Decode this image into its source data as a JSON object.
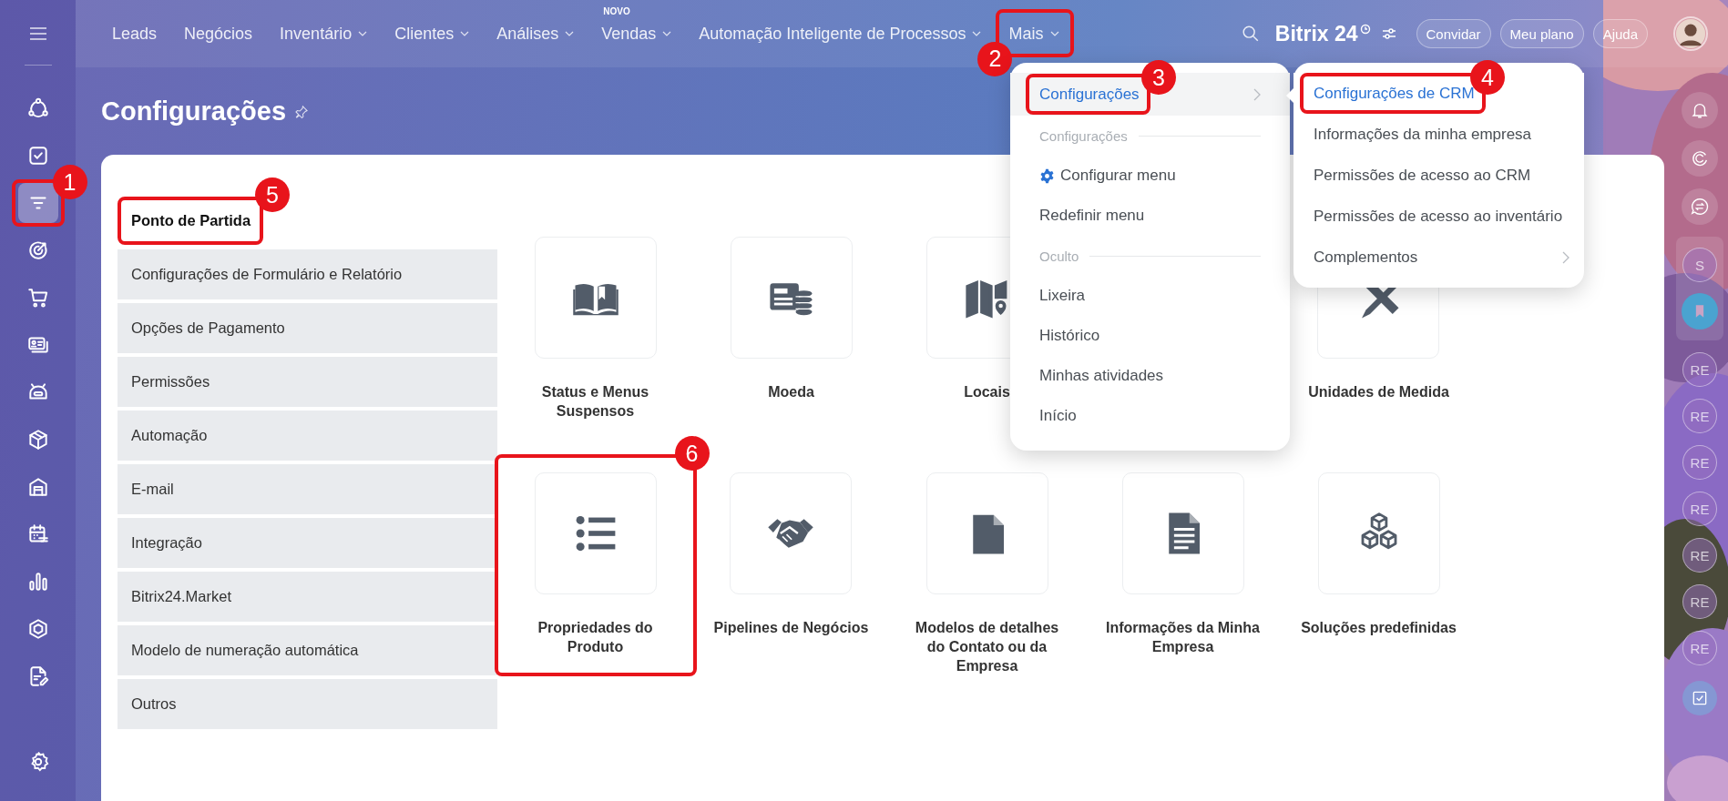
{
  "sidebar": {
    "items": [
      {
        "selected": false
      },
      {
        "selected": false
      },
      {
        "selected": true,
        "callout": "1"
      },
      {
        "selected": false
      },
      {
        "selected": false
      },
      {
        "selected": false
      },
      {
        "selected": false
      },
      {
        "selected": false
      },
      {
        "selected": false
      },
      {
        "selected": false
      },
      {
        "selected": false
      },
      {
        "selected": false
      },
      {
        "selected": false
      }
    ]
  },
  "top_nav": {
    "items": [
      {
        "label": "Leads",
        "dropdown": false
      },
      {
        "label": "Negócios",
        "dropdown": false
      },
      {
        "label": "Inventário",
        "dropdown": true
      },
      {
        "label": "Clientes",
        "dropdown": true
      },
      {
        "label": "Análises",
        "dropdown": true
      },
      {
        "label": "Vendas",
        "dropdown": true,
        "badge": "NOVO"
      },
      {
        "label": "Automação Inteligente de Processos",
        "dropdown": true
      },
      {
        "label": "Mais",
        "dropdown": true,
        "callout": "2"
      }
    ]
  },
  "logo": "Bitrix 24",
  "header_buttons": [
    "Convidar",
    "Meu plano",
    "Ajuda"
  ],
  "page": {
    "title": "Configurações"
  },
  "settings_nav": [
    {
      "label": "Ponto de Partida",
      "selected": true,
      "callout": "5"
    },
    {
      "label": "Configurações de Formulário e Relatório",
      "selected": false
    },
    {
      "label": "Opções de Pagamento",
      "selected": false
    },
    {
      "label": "Permissões",
      "selected": false
    },
    {
      "label": "Automação",
      "selected": false
    },
    {
      "label": "E-mail",
      "selected": false
    },
    {
      "label": "Integração",
      "selected": false
    },
    {
      "label": "Bitrix24.Market",
      "selected": false
    },
    {
      "label": "Modelo de numeração automática",
      "selected": false
    },
    {
      "label": "Outros",
      "selected": false
    }
  ],
  "tiles": [
    {
      "kind": "tile",
      "label": "Status e Menus Suspensos"
    },
    {
      "kind": "tile",
      "label": "Moeda"
    },
    {
      "kind": "tile",
      "label": "Locais"
    },
    {
      "kind": "covered"
    },
    {
      "kind": "tile",
      "label": "Unidades de Medida"
    },
    {
      "kind": "tile",
      "label": "Propriedades do Produto",
      "callout": "6"
    },
    {
      "kind": "tile",
      "label": "Pipelines de Negócios"
    },
    {
      "kind": "tile",
      "label": "Modelos de detalhes do Contato ou da Empresa"
    },
    {
      "kind": "tile",
      "label": "Informações da Minha Empresa"
    },
    {
      "kind": "tile",
      "label": "Soluções predefinidas"
    }
  ],
  "menu": {
    "items": [
      {
        "kind": "item",
        "label": "Configurações",
        "selected": true,
        "submenu": true,
        "callout": "3"
      },
      {
        "kind": "section",
        "label": "Configurações"
      },
      {
        "kind": "setting",
        "label": "Configurar menu"
      },
      {
        "kind": "item",
        "label": "Redefinir menu",
        "selected": false,
        "submenu": false
      },
      {
        "kind": "section",
        "label": "Oculto"
      },
      {
        "kind": "item",
        "label": "Lixeira",
        "selected": false,
        "submenu": false
      },
      {
        "kind": "item",
        "label": "Histórico",
        "selected": false,
        "submenu": false
      },
      {
        "kind": "item",
        "label": "Minhas atividades",
        "selected": false,
        "submenu": false
      },
      {
        "kind": "item",
        "label": "Início",
        "selected": false,
        "submenu": false
      }
    ]
  },
  "submenu": {
    "items": [
      {
        "label": "Configurações de CRM",
        "selected": true,
        "submenu": false,
        "callout": "4"
      },
      {
        "label": "Informações da minha empresa",
        "selected": false,
        "submenu": false
      },
      {
        "label": "Permissões de acesso ao CRM",
        "selected": false,
        "submenu": false
      },
      {
        "label": "Permissões de acesso ao inventário",
        "selected": false,
        "submenu": false
      },
      {
        "label": "Complementos",
        "selected": false,
        "submenu": true
      }
    ]
  },
  "right_bar": {
    "pinned": [
      {
        "initials": "S"
      }
    ],
    "chats": [
      {
        "initials": "RE"
      },
      {
        "initials": "RE"
      },
      {
        "initials": "RE"
      },
      {
        "initials": "RE"
      },
      {
        "initials": "RE"
      },
      {
        "initials": "RE"
      },
      {
        "initials": "RE"
      }
    ]
  }
}
